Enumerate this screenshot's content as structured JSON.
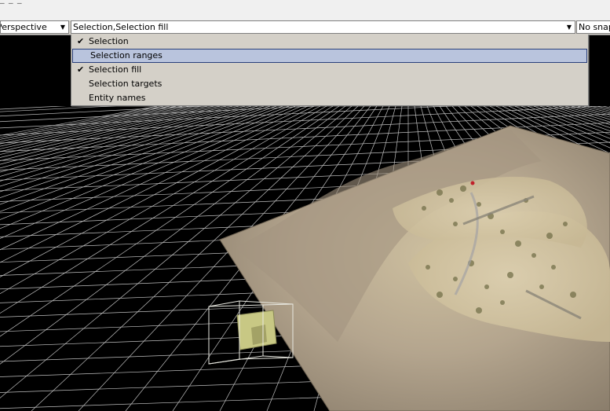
{
  "toolbar": {
    "view_value": "Perspective",
    "display_value": "Selection,Selection fill",
    "snap_value": "No snapping"
  },
  "dropdown": {
    "items": [
      {
        "label": "Selection",
        "checked": true,
        "highlighted": false
      },
      {
        "label": "Selection ranges",
        "checked": false,
        "highlighted": true
      },
      {
        "label": "Selection fill",
        "checked": true,
        "highlighted": false
      },
      {
        "label": "Selection targets",
        "checked": false,
        "highlighted": false
      },
      {
        "label": "Entity names",
        "checked": false,
        "highlighted": false
      }
    ]
  },
  "icons": {
    "combo_arrow": "chevron-down-icon",
    "check": "check-icon"
  },
  "colors": {
    "grid": "#ffffff",
    "terrain": "#b4a58e",
    "terrain_dark": "#7a6d5c",
    "entity": "#c8c884",
    "highlight": "#b9c4dd"
  }
}
